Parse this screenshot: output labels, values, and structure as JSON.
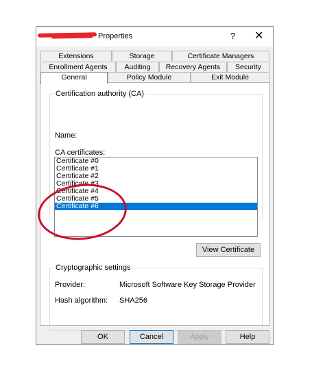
{
  "window": {
    "title_suffix": "Properties",
    "help_symbol": "?",
    "close_symbol": "✕"
  },
  "tabs": {
    "row1": [
      "Extensions",
      "Storage",
      "Certificate Managers"
    ],
    "row2": [
      "Enrollment Agents",
      "Auditing",
      "Recovery Agents",
      "Security"
    ],
    "row3": [
      "General",
      "Policy Module",
      "Exit Module"
    ],
    "active": "General"
  },
  "ca_group": {
    "legend": "Certification authority (CA)",
    "name_label": "Name:",
    "certs_label": "CA certificates:",
    "certificates": [
      "Certificate #0",
      "Certificate #1",
      "Certificate #2",
      "Certificate #3",
      "Certificate #4",
      "Certificate #5",
      "Certificate #6"
    ],
    "selected_index": 6,
    "view_button": "View Certificate"
  },
  "crypto_group": {
    "legend": "Cryptographic settings",
    "provider_label": "Provider:",
    "provider_value": "Microsoft Software Key Storage Provider",
    "hash_label": "Hash algorithm:",
    "hash_value": "SHA256"
  },
  "buttons": {
    "ok": "OK",
    "cancel": "Cancel",
    "apply": "Apply",
    "help": "Help"
  },
  "colors": {
    "selection": "#0078d7",
    "annotation_red": "#c8102e"
  }
}
